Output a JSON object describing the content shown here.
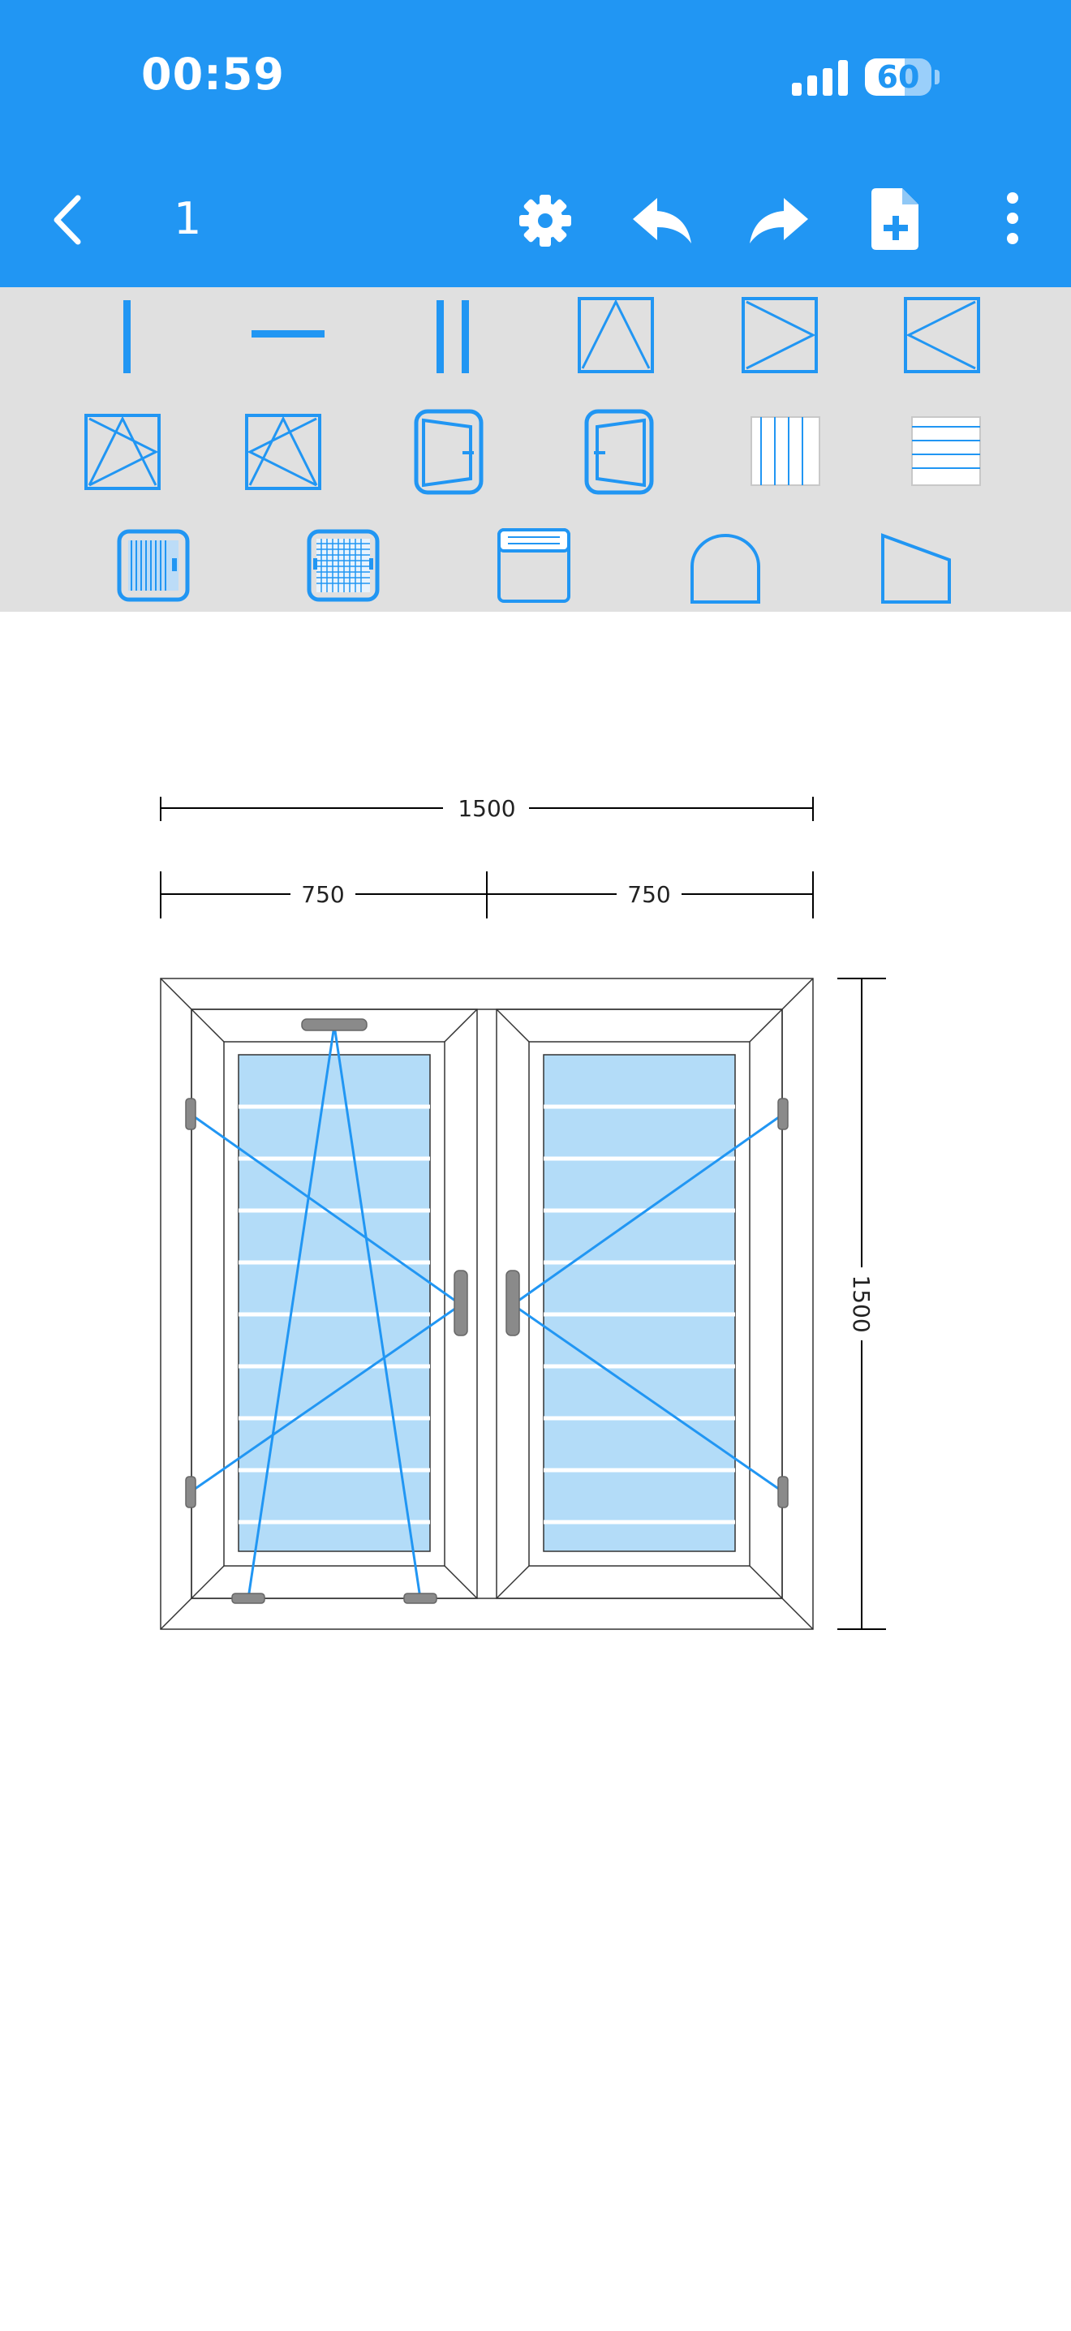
{
  "status_bar": {
    "time": "00:59",
    "battery_level": "60",
    "battery_fraction": 0.6
  },
  "nav_bar": {
    "page_number": "1",
    "icons": [
      "back-chevron-icon",
      "gear-icon",
      "undo-icon",
      "redo-icon",
      "add-document-icon",
      "more-vertical-icon"
    ]
  },
  "toolbar": {
    "tools": [
      "vertical-mullion",
      "horizontal-transom",
      "double-vertical-mullion",
      "top-hung-sash",
      "side-hung-sash-left",
      "side-hung-sash-right",
      "tilt-turn-left-sash",
      "tilt-turn-right-sash",
      "door-left",
      "door-right",
      "vertical-blinds",
      "horizontal-blinds",
      "roller-shutter",
      "mosquito-net",
      "box-shutter",
      "arched-frame",
      "sloped-frame"
    ]
  },
  "drawing": {
    "overall_width": "1500",
    "sash_widths": [
      "750",
      "750"
    ],
    "overall_height": "1500"
  },
  "colors": {
    "header": "#2196F3",
    "toolbar_bg": "#e0e0e0",
    "icon_blue": "#2196F3",
    "glass": "#b3dcf8",
    "handle": "#8a8a8a"
  }
}
